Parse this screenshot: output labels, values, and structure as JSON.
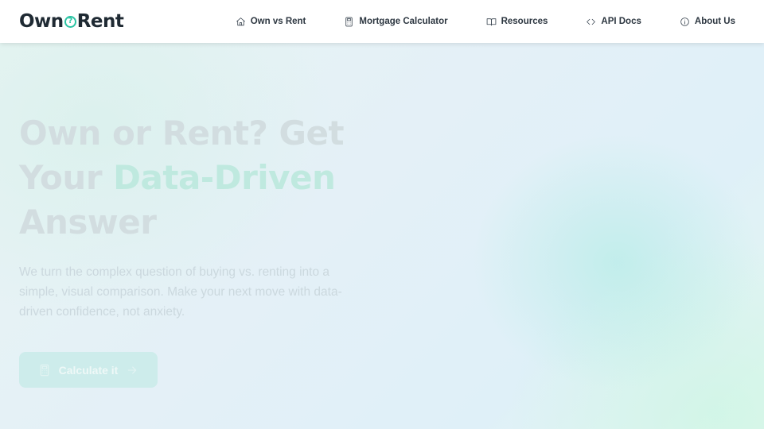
{
  "brand": {
    "part1": "Own",
    "part2": "?",
    "part3": "Rent",
    "accent_color": "#2bc4a4"
  },
  "nav": [
    {
      "label": "Own vs Rent",
      "icon": "home-icon"
    },
    {
      "label": "Mortgage Calculator",
      "icon": "calculator-icon"
    },
    {
      "label": "Resources",
      "icon": "book-icon"
    },
    {
      "label": "API Docs",
      "icon": "code-icon"
    },
    {
      "label": "About Us",
      "icon": "info-icon"
    }
  ],
  "hero": {
    "title_line1": "Own or Rent? Get",
    "title_line2": "Your ",
    "title_accent": "Data-Driven",
    "title_line3": "Answer",
    "subtitle": "We turn the complex question of buying vs. renting into a simple, visual comparison. Make your next move with data-driven confidence, not anxiety.",
    "cta_label": "Calculate it"
  }
}
